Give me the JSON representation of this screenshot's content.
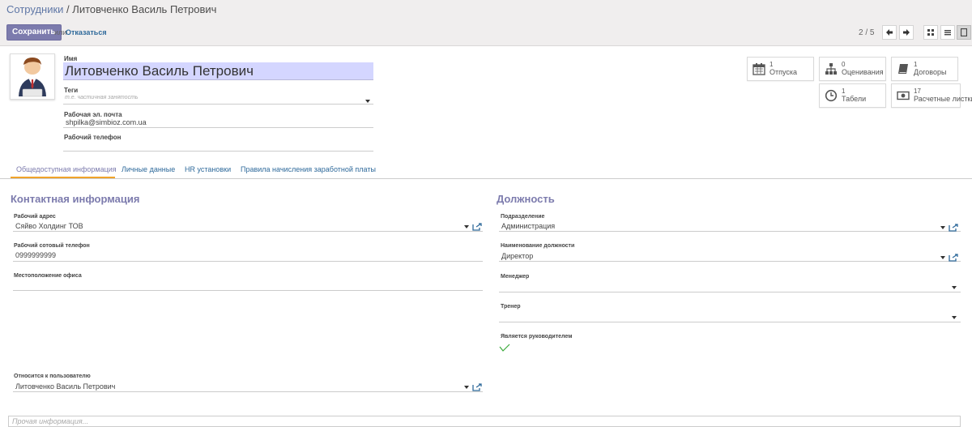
{
  "breadcrumb": {
    "parent": "Сотрудники",
    "separator": "/",
    "current": "Литовченко Василь Петрович"
  },
  "toolbar": {
    "save_label": "Сохранить",
    "or_text": "или",
    "discard_label": "Отказаться"
  },
  "pager": {
    "value": "2 / 5"
  },
  "employee": {
    "name_label": "Имя",
    "name": "Литовченко Василь Петрович",
    "tags_label": "Теги",
    "tags_placeholder": "т.е. частичная занятость",
    "work_email_label": "Рабочая эл. почта",
    "work_email": "shpilka@simbioz.com.ua",
    "work_phone_label": "Рабочий телефон",
    "work_phone": ""
  },
  "smart_buttons": [
    {
      "count": "1",
      "label": "Отпуска",
      "icon": "calendar-icon"
    },
    {
      "count": "0",
      "label": "Оценивания",
      "icon": "sitemap-icon"
    },
    {
      "count": "1",
      "label": "Договоры",
      "icon": "book-icon"
    },
    {
      "count": "1",
      "label": "Табели",
      "icon": "clock-icon"
    },
    {
      "count": "17",
      "label": "Расчетные листки",
      "icon": "money-icon"
    }
  ],
  "tabs": [
    {
      "label": "Общедоступная информация",
      "active": true
    },
    {
      "label": "Личные данные",
      "active": false
    },
    {
      "label": "HR установки",
      "active": false
    },
    {
      "label": "Правила начисления заработной платы",
      "active": false
    }
  ],
  "contact": {
    "title": "Контактная информация",
    "work_address_label": "Рабочий адрес",
    "work_address": "Сяйво Холдинг ТОВ",
    "mobile_label": "Рабочий сотовый телефон",
    "mobile": "0999999999",
    "office_label": "Местоположение офиса",
    "office": "",
    "user_label": "Относится к пользователю",
    "user": "Литовченко Василь Петрович"
  },
  "position": {
    "title": "Должность",
    "department_label": "Подразделение",
    "department": "Администрация",
    "job_label": "Наименование должности",
    "job": "Директор",
    "manager_label": "Менеджер",
    "manager": "",
    "coach_label": "Тренер",
    "coach": "",
    "is_manager_label": "Является руководителем",
    "is_manager": true
  },
  "other_info_placeholder": "Прочая информация...",
  "colors": {
    "accent": "#7c7bad",
    "link": "#2f6a9b",
    "tab_active_underline": "#f0a32a",
    "name_bg": "#d4d6ff",
    "check": "#3cab3c"
  }
}
